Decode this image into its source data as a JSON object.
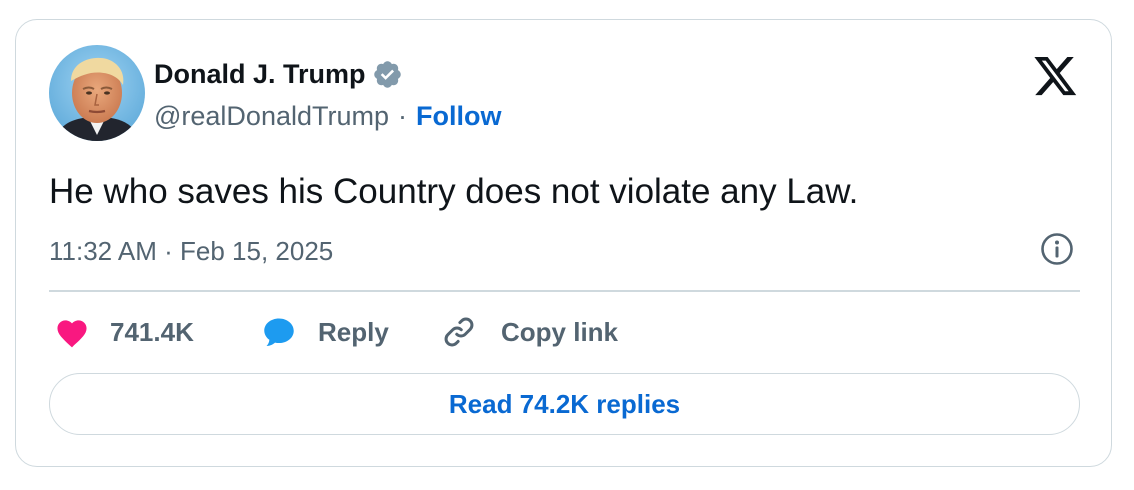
{
  "author": {
    "name": "Donald J. Trump",
    "handle": "@realDonaldTrump",
    "separator": "·",
    "follow_label": "Follow"
  },
  "tweet": {
    "text": "He who saves his Country does not violate any Law.",
    "timestamp": "11:32 AM · Feb 15, 2025"
  },
  "actions": {
    "like_count": "741.4K",
    "reply_label": "Reply",
    "copy_label": "Copy link"
  },
  "read_replies_label": "Read 74.2K replies",
  "icons": {
    "verified": "verified-badge-icon",
    "brand": "x-logo-icon",
    "info": "info-icon",
    "like": "heart-icon",
    "reply": "speech-bubble-icon",
    "copy": "link-icon"
  },
  "colors": {
    "text": "#0f1419",
    "muted": "#536471",
    "link": "#0969d2",
    "like": "#f91880",
    "reply": "#1d9bf0",
    "verified": "#829aab",
    "border": "#cfd9de"
  }
}
